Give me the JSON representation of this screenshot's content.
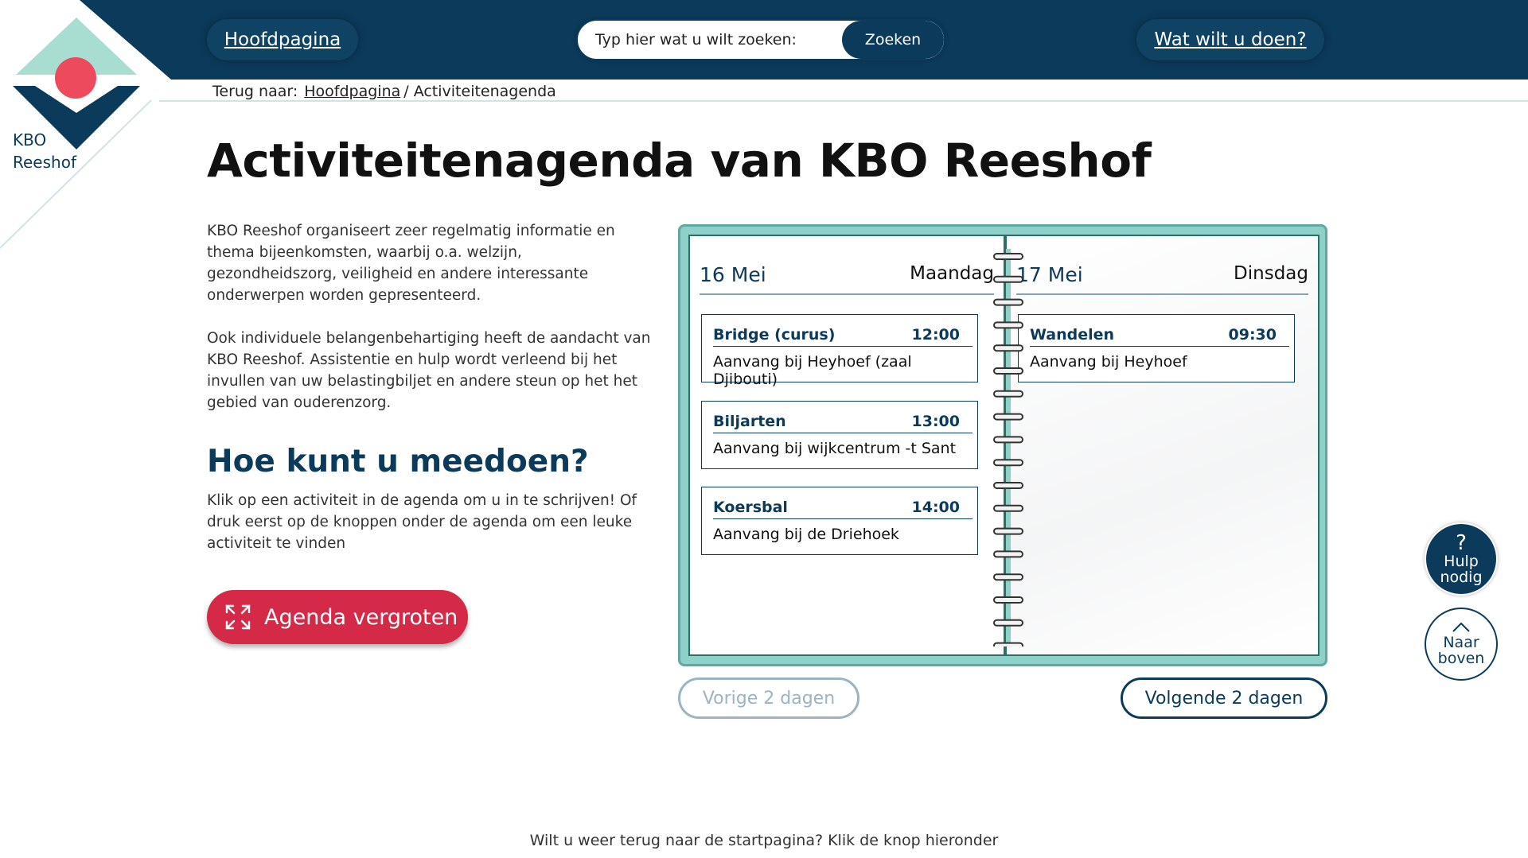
{
  "header": {
    "nav_home": "Hoofdpagina",
    "search_placeholder": "Typ hier wat u wilt zoeken:",
    "search_button": "Zoeken",
    "nav_doen": "Wat wilt u doen?"
  },
  "logo": {
    "line1": "KBO",
    "line2": "Reeshof"
  },
  "breadcrumb": {
    "prefix": "Terug naar:",
    "link": "Hoofdpagina",
    "current": "/ Activiteitenagenda"
  },
  "main": {
    "title": "Activiteitenagenda van KBO Reeshof",
    "paragraph1": "KBO Reeshof organiseert zeer regelmatig informatie en thema bijeenkomsten, waarbij o.a. welzijn, gezondheidszorg, veiligheid en andere interessante onderwerpen worden gepresenteerd.",
    "paragraph2": "Ook individuele belangenbehartiging heeft de aandacht van KBO Reeshof. Assistentie en hulp wordt verleend bij het invullen van uw belastingbiljet en andere steun op het het gebied van ouderenzorg.",
    "subheading": "Hoe kunt u meedoen?",
    "paragraph3": "Klik op een activiteit in de agenda om u in te schrijven! Of druk eerst op de knoppen onder de agenda om een leuke activiteit te vinden",
    "enlarge_button": "Agenda vergroten"
  },
  "agenda": {
    "days": [
      {
        "date": "16 Mei",
        "weekday": "Maandag",
        "events": [
          {
            "name": "Bridge (curus)",
            "time": "12:00",
            "location": "Aanvang bij Heyhoef (zaal Djibouti)"
          },
          {
            "name": "Biljarten",
            "time": "13:00",
            "location": "Aanvang bij wijkcentrum -t Sant"
          },
          {
            "name": "Koersbal",
            "time": "14:00",
            "location": "Aanvang bij de Driehoek"
          }
        ]
      },
      {
        "date": "17 Mei",
        "weekday": "Dinsdag",
        "events": [
          {
            "name": "Wandelen",
            "time": "09:30",
            "location": "Aanvang bij Heyhoef"
          }
        ]
      }
    ],
    "prev_button": "Vorige 2 dagen",
    "next_button": "Volgende 2 dagen"
  },
  "floating": {
    "help_symbol": "?",
    "help_line1": "Hulp",
    "help_line2": "nodig",
    "top_line1": "Naar",
    "top_line2": "boven"
  },
  "footer": {
    "text": "Wilt u weer terug naar de startpagina? Klik de knop hieronder"
  },
  "colors": {
    "navy": "#0c3a5b",
    "teal": "#8fd0c9",
    "red": "#d42a48",
    "mint": "#a8ddd2"
  }
}
